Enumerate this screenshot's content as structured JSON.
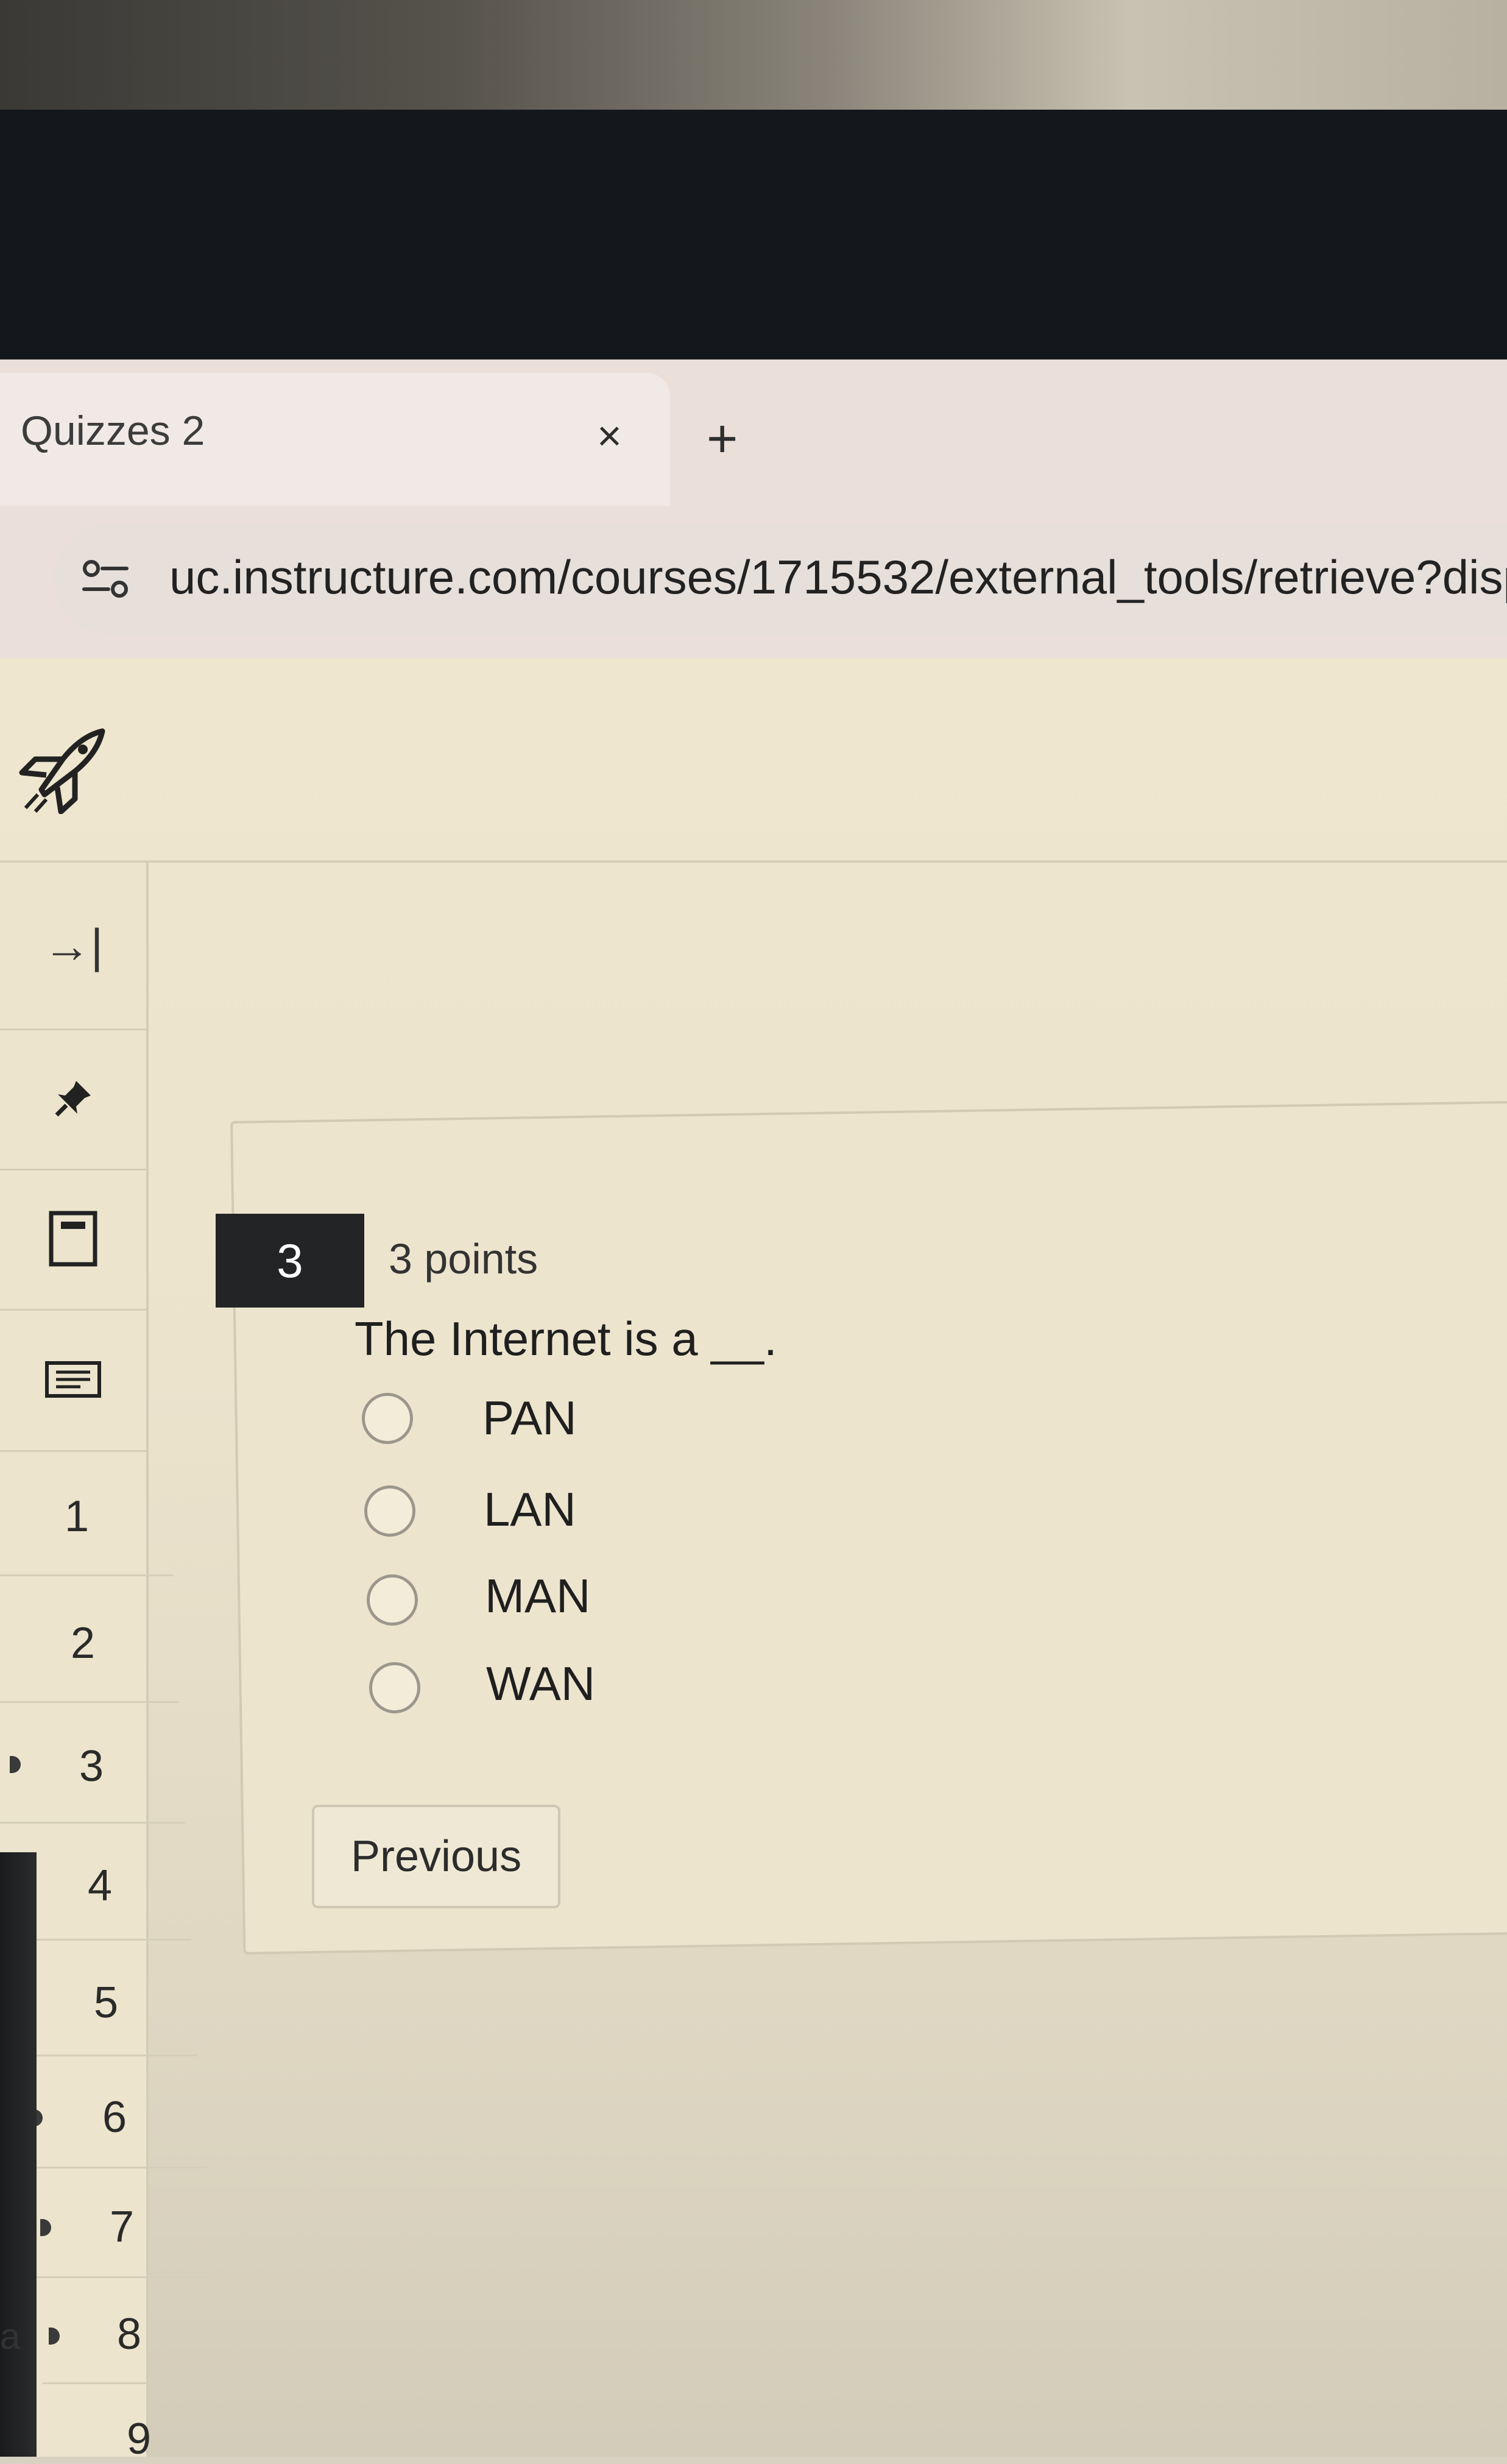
{
  "browser": {
    "tab_title": "Quizzes 2",
    "tab_close": "×",
    "new_tab": "+",
    "url": "uc.instructure.com/courses/1715532/external_tools/retrieve?displa"
  },
  "sidebar": {
    "collapse_icon": "→|",
    "questions": [
      "1",
      "2",
      "3",
      "4",
      "5",
      "6",
      "7",
      "8",
      "9"
    ]
  },
  "question": {
    "number": "3",
    "points": "3 points",
    "text": "The Internet is a __.",
    "options": [
      "PAN",
      "LAN",
      "MAN",
      "WAN"
    ]
  },
  "buttons": {
    "previous": "Previous"
  },
  "misc": {
    "stray_letter": "a"
  },
  "icons": [
    "rocket-icon",
    "collapse-arrow-icon",
    "pin-icon",
    "calculator-icon",
    "notes-icon",
    "site-info-icon"
  ]
}
